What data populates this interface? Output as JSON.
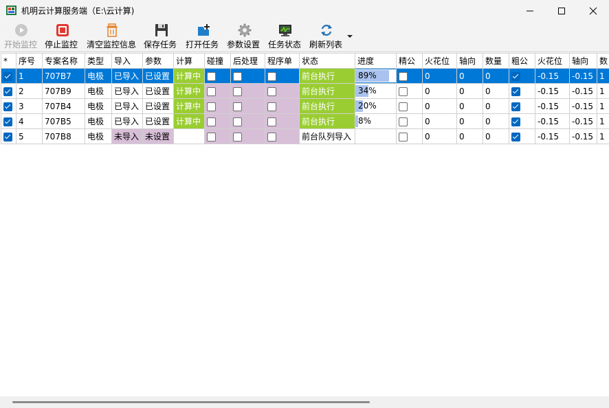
{
  "window": {
    "title": "机明云计算服务端（E:\\云计算)"
  },
  "toolbar": [
    {
      "label": "开始监控",
      "icon": "play-icon",
      "enabled": false
    },
    {
      "label": "停止监控",
      "icon": "stop-icon",
      "enabled": true
    },
    {
      "label": "清空监控信息",
      "icon": "trash-icon",
      "enabled": true
    },
    {
      "label": "保存任务",
      "icon": "save-icon",
      "enabled": true
    },
    {
      "label": "打开任务",
      "icon": "open-task-icon",
      "enabled": true
    },
    {
      "label": "参数设置",
      "icon": "gear-icon",
      "enabled": true
    },
    {
      "label": "任务状态",
      "icon": "monitor-icon",
      "enabled": true
    },
    {
      "label": "刷新列表",
      "icon": "refresh-icon",
      "enabled": true
    }
  ],
  "columns": [
    "*",
    "序号",
    "专案名称",
    "类型",
    "导入",
    "参数",
    "计算",
    "碰撞",
    "后处理",
    "程序单",
    "状态",
    "进度",
    "精公",
    "火花位",
    "轴向",
    "数量",
    "粗公",
    "火花位",
    "轴向",
    "数"
  ],
  "rows": [
    {
      "checked": true,
      "index": "1",
      "name": "707B7",
      "type": "电极",
      "import": "已导入",
      "params": "已设置",
      "calc": "计算中",
      "collision": false,
      "post": false,
      "program": false,
      "status": "前台执行",
      "progress": 89,
      "progress_text": "89%",
      "fine": false,
      "fine_spark": "0",
      "fine_axis": "0",
      "qty": "0",
      "rough": true,
      "rough_spark": "-0.15",
      "rough_axis": "-0.15",
      "rough_qty": "1",
      "selected": true
    },
    {
      "checked": true,
      "index": "2",
      "name": "707B9",
      "type": "电极",
      "import": "已导入",
      "params": "已设置",
      "calc": "计算中",
      "collision": false,
      "post": false,
      "program": false,
      "status": "前台执行",
      "progress": 34,
      "progress_text": "34%",
      "fine": false,
      "fine_spark": "0",
      "fine_axis": "0",
      "qty": "0",
      "rough": true,
      "rough_spark": "-0.15",
      "rough_axis": "-0.15",
      "rough_qty": "1",
      "selected": false
    },
    {
      "checked": true,
      "index": "3",
      "name": "707B4",
      "type": "电极",
      "import": "已导入",
      "params": "已设置",
      "calc": "计算中",
      "collision": false,
      "post": false,
      "program": false,
      "status": "前台执行",
      "progress": 20,
      "progress_text": "20%",
      "fine": false,
      "fine_spark": "0",
      "fine_axis": "0",
      "qty": "0",
      "rough": true,
      "rough_spark": "-0.15",
      "rough_axis": "-0.15",
      "rough_qty": "1",
      "selected": false
    },
    {
      "checked": true,
      "index": "4",
      "name": "707B5",
      "type": "电极",
      "import": "已导入",
      "params": "已设置",
      "calc": "计算中",
      "collision": false,
      "post": false,
      "program": false,
      "status": "前台执行",
      "progress": 8,
      "progress_text": "8%",
      "fine": false,
      "fine_spark": "0",
      "fine_axis": "0",
      "qty": "0",
      "rough": true,
      "rough_spark": "-0.15",
      "rough_axis": "-0.15",
      "rough_qty": "1",
      "selected": false
    },
    {
      "checked": true,
      "index": "5",
      "name": "707B8",
      "type": "电极",
      "import": "未导入",
      "params": "未设置",
      "calc": "",
      "collision": false,
      "post": false,
      "program": false,
      "status": "前台队列导入",
      "progress": null,
      "progress_text": "",
      "fine": false,
      "fine_spark": "0",
      "fine_axis": "0",
      "qty": "0",
      "rough": true,
      "rough_spark": "-0.15",
      "rough_axis": "-0.15",
      "rough_qty": "1",
      "selected": false
    }
  ],
  "colors": {
    "selection": "#0078d7",
    "calc_green": "#9acd32",
    "pending_purple": "#d8bfd8",
    "progress_fill": "#a9c2ef"
  }
}
